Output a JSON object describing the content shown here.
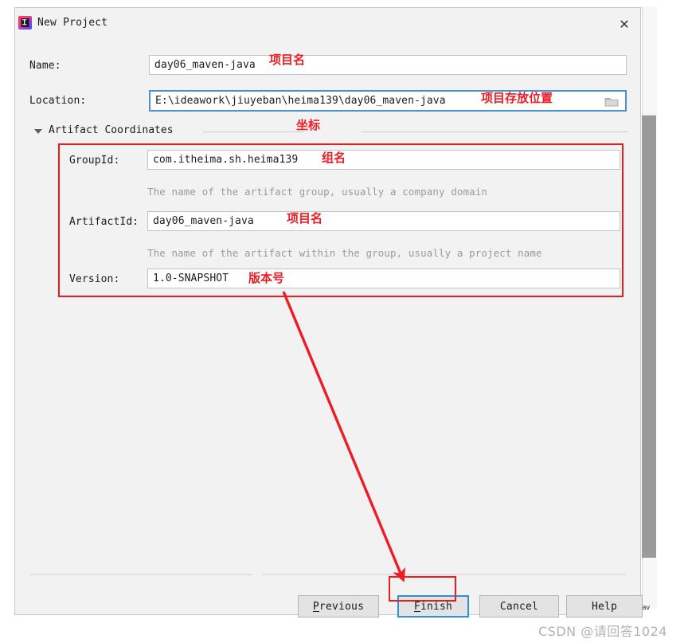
{
  "dialog": {
    "title": "New Project",
    "icon": "intellij-idea-logo",
    "close_label": "✕"
  },
  "form": {
    "name": {
      "label": "Name:",
      "value": "day06_maven-java"
    },
    "location": {
      "label": "Location:",
      "value": "E:\\ideawork\\jiuyeban\\heima139\\day06_maven-java",
      "browse_icon": "folder-icon"
    }
  },
  "artifact_section": {
    "title": "Artifact Coordinates",
    "expanded": true,
    "fields": [
      {
        "label": "GroupId:",
        "value": "com.itheima.sh.heima139",
        "hint": "The name of the artifact group, usually a company domain"
      },
      {
        "label": "ArtifactId:",
        "value": "day06_maven-java",
        "hint": "The name of the artifact within the group, usually a project name"
      },
      {
        "label": "Version:",
        "value": "1.0-SNAPSHOT",
        "hint": ""
      }
    ]
  },
  "buttons": {
    "previous": {
      "prefix": "",
      "mnemonic": "P",
      "suffix": "revious"
    },
    "finish": {
      "prefix": "",
      "mnemonic": "F",
      "suffix": "inish"
    },
    "cancel": {
      "prefix": "",
      "mnemonic": "",
      "suffix": "Cancel"
    },
    "help": {
      "prefix": "",
      "mnemonic": "",
      "suffix": "Help"
    },
    "previous_label": "Previous",
    "finish_label": "Finish",
    "cancel_label": "Cancel",
    "help_label": "Help"
  },
  "annotations": {
    "name": "项目名",
    "location": "项目存放位置",
    "coordinates": "坐标",
    "groupid": "组名",
    "artifactid": "项目名",
    "version": "版本号",
    "arrow_color": "#ee1c25",
    "box_color": "#f01a1a"
  },
  "background": {
    "tail_text": "av"
  },
  "watermark": {
    "text": "CSDN @请回答1024"
  },
  "theme": {
    "dialog_bg": "#f2f2f2",
    "field_bg": "#ffffff",
    "focus_blue": "#4a90d9",
    "button_bg": "#e3e3e3",
    "hint_gray": "#9a9a9a"
  }
}
